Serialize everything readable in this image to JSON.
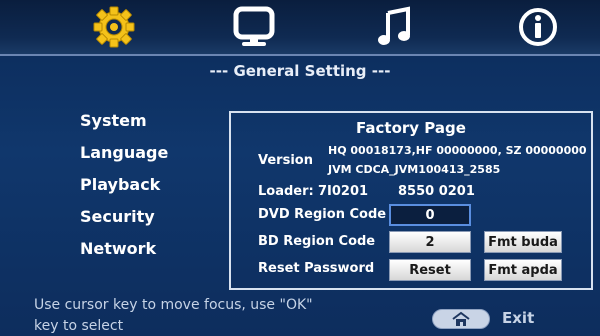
{
  "header": {
    "icons": [
      {
        "name": "settings-gear-icon",
        "color": "#f4c21a"
      },
      {
        "name": "monitor-icon",
        "color": "#ffffff"
      },
      {
        "name": "music-note-icon",
        "color": "#ffffff"
      },
      {
        "name": "info-icon",
        "color": "#ffffff"
      }
    ],
    "section_title": "--- General Setting ---"
  },
  "sidebar": {
    "items": [
      {
        "label": "System"
      },
      {
        "label": "Language"
      },
      {
        "label": "Playback"
      },
      {
        "label": "Security"
      },
      {
        "label": "Network"
      }
    ]
  },
  "factory": {
    "title": "Factory Page",
    "version_label": "Version",
    "version_line1": "HQ 00018173,HF 00000000, SZ 00000000",
    "version_line2": "JVM CDCA_JVM100413_2585",
    "loader_label": "Loader:",
    "loader_value1": "7I0201",
    "loader_value2": "8550 0201",
    "dvd_region_label": "DVD Region Code",
    "dvd_region_value": "0",
    "bd_region_label": "BD Region Code",
    "bd_region_value": "2",
    "fmt_buda_label": "Fmt buda",
    "reset_password_label": "Reset Password",
    "reset_button_label": "Reset",
    "fmt_apda_label": "Fmt apda"
  },
  "footer": {
    "hint_line1": "Use cursor key to move focus, use \"OK\"",
    "hint_line2": "key to select",
    "exit_label": "Exit"
  },
  "colors": {
    "background": "#0e2e5c",
    "accent_gear": "#f4c21a",
    "focus_border": "#5a8ee0"
  }
}
